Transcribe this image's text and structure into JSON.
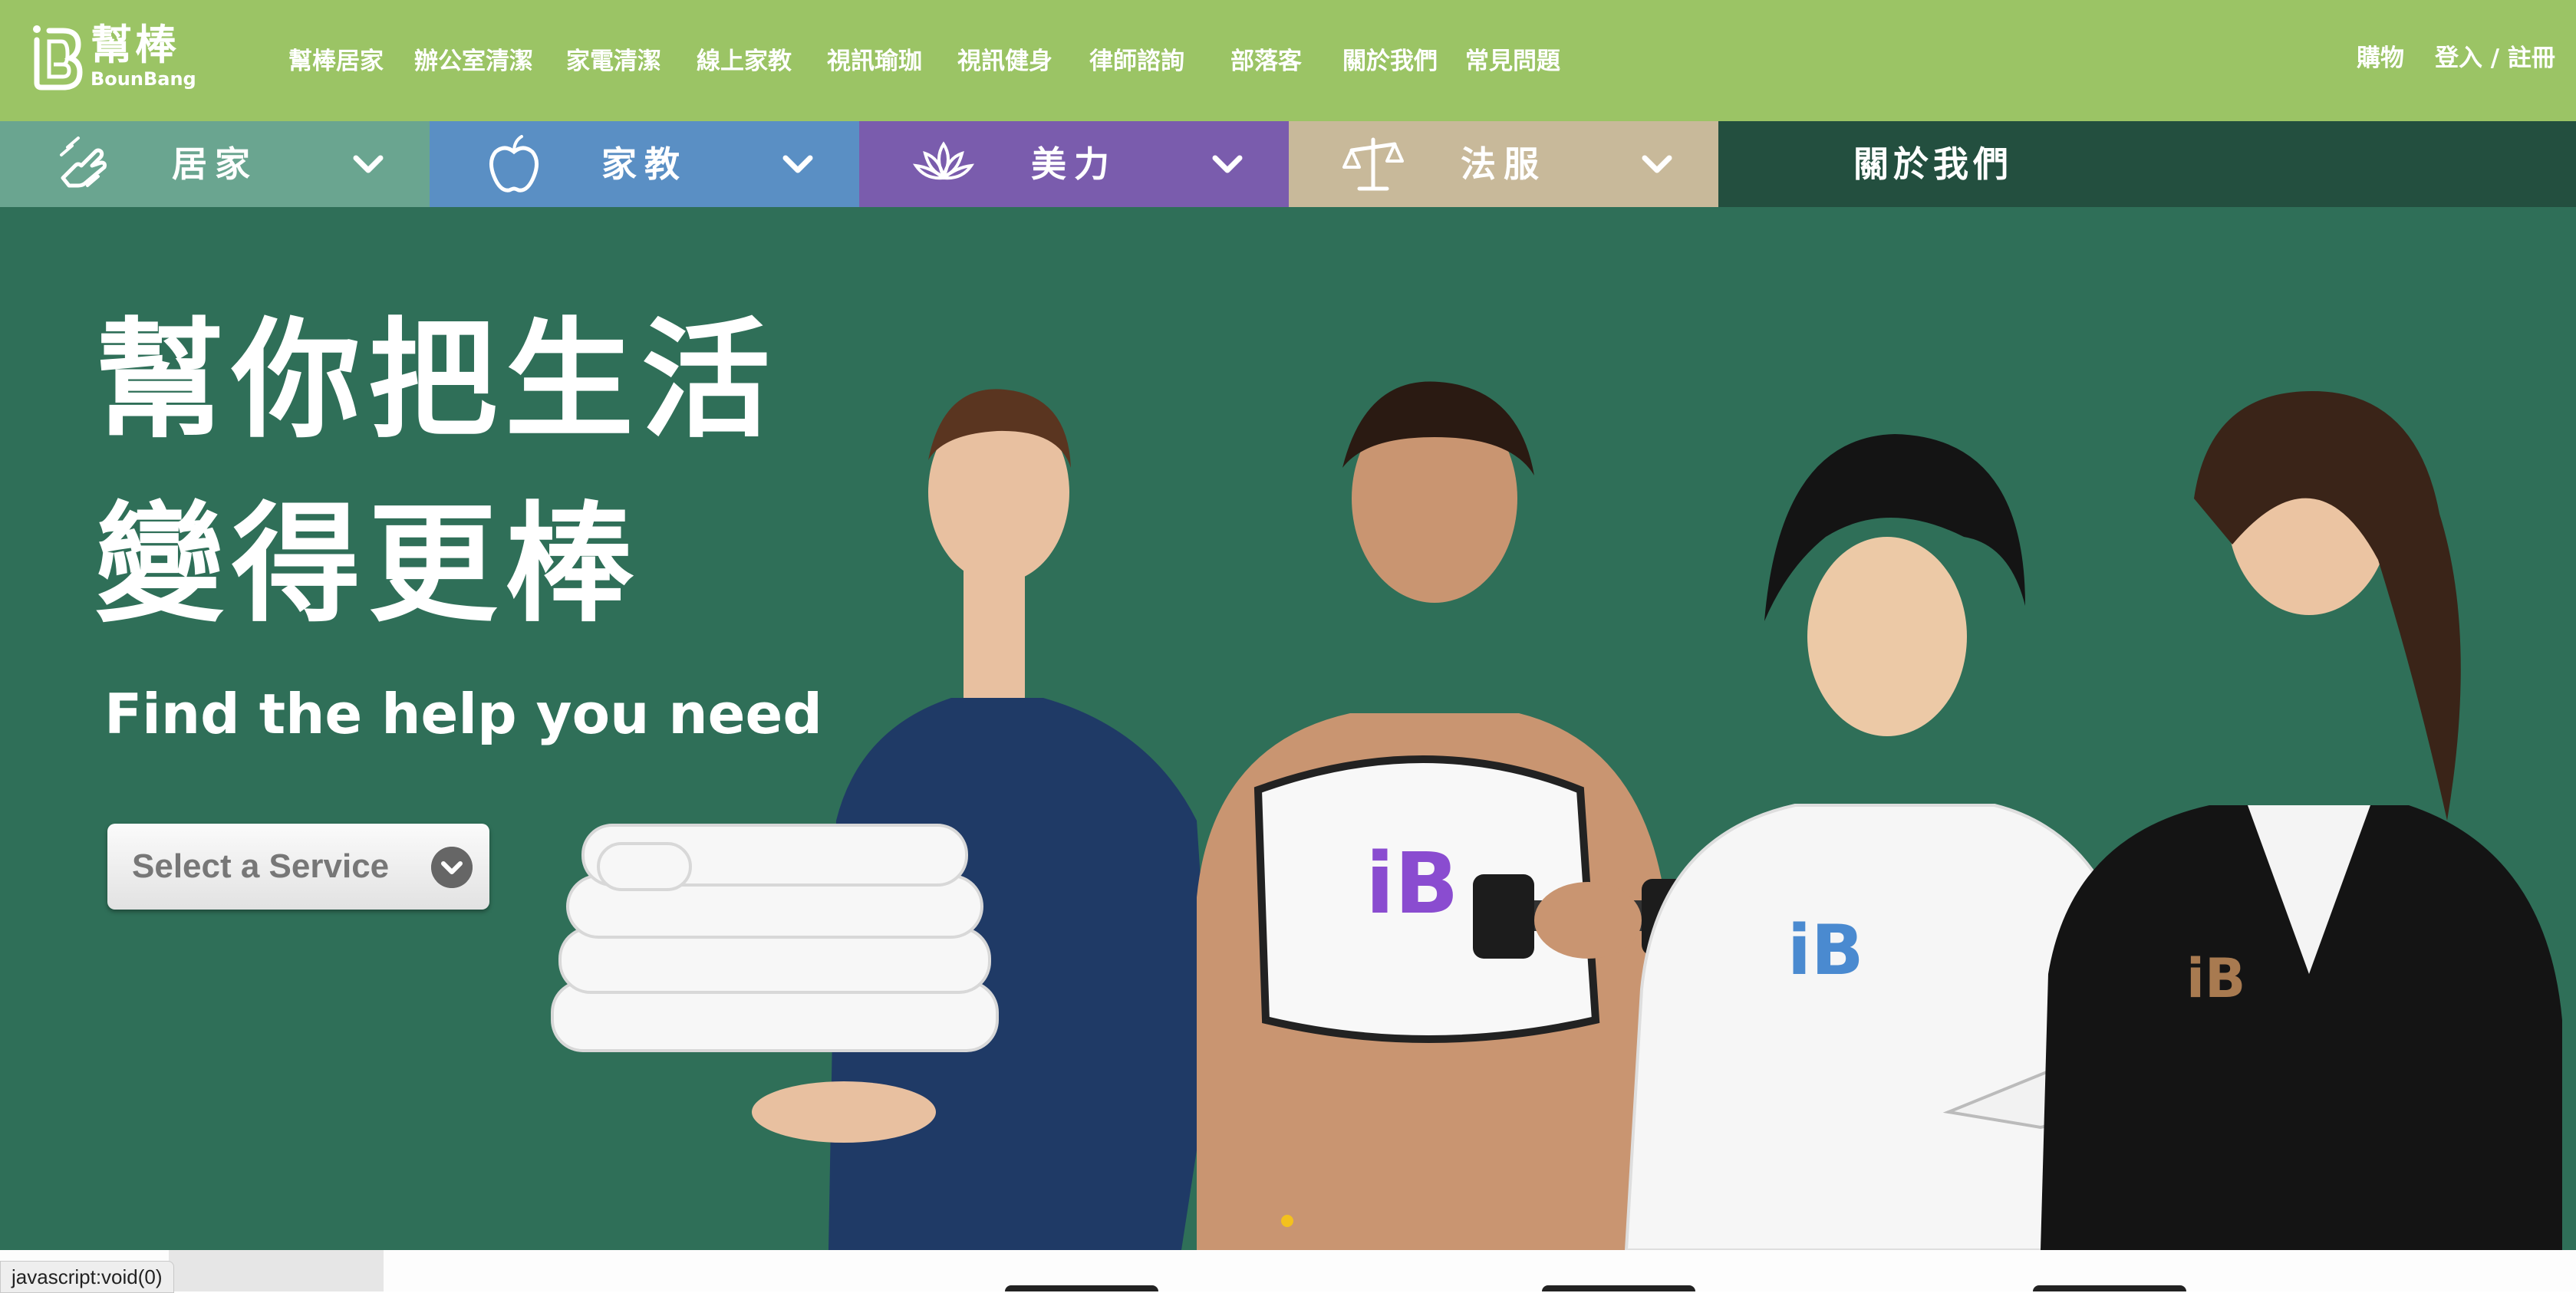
{
  "brand": {
    "name_cn": "幫棒",
    "name_en": "BounBang"
  },
  "nav": {
    "items": [
      "幫棒居家",
      "辦公室清潔",
      "家電清潔",
      "線上家教",
      "視訊瑜珈",
      "視訊健身",
      "律師諮詢",
      "部落客",
      "關於我們",
      "常見問題"
    ],
    "shop": "購物",
    "auth": "登入 / 註冊"
  },
  "categories": [
    {
      "label": "居家",
      "icon": "cleaning-hand-icon",
      "color": "#6aa590"
    },
    {
      "label": "家教",
      "icon": "apple-icon",
      "color": "#5a8fc4"
    },
    {
      "label": "美力",
      "icon": "lotus-icon",
      "color": "#7a5cad"
    },
    {
      "label": "法服",
      "icon": "scales-icon",
      "color": "#c8b99a"
    },
    {
      "label": "關於我們",
      "color": "#234f3f"
    }
  ],
  "hero": {
    "headline_1": "幫你把生活",
    "headline_2": "變得更棒",
    "tagline": "Find the help you need",
    "select_label": "Select a Service",
    "background": "#2f6f58"
  },
  "statusbar": {
    "text": "javascript:void(0)"
  }
}
